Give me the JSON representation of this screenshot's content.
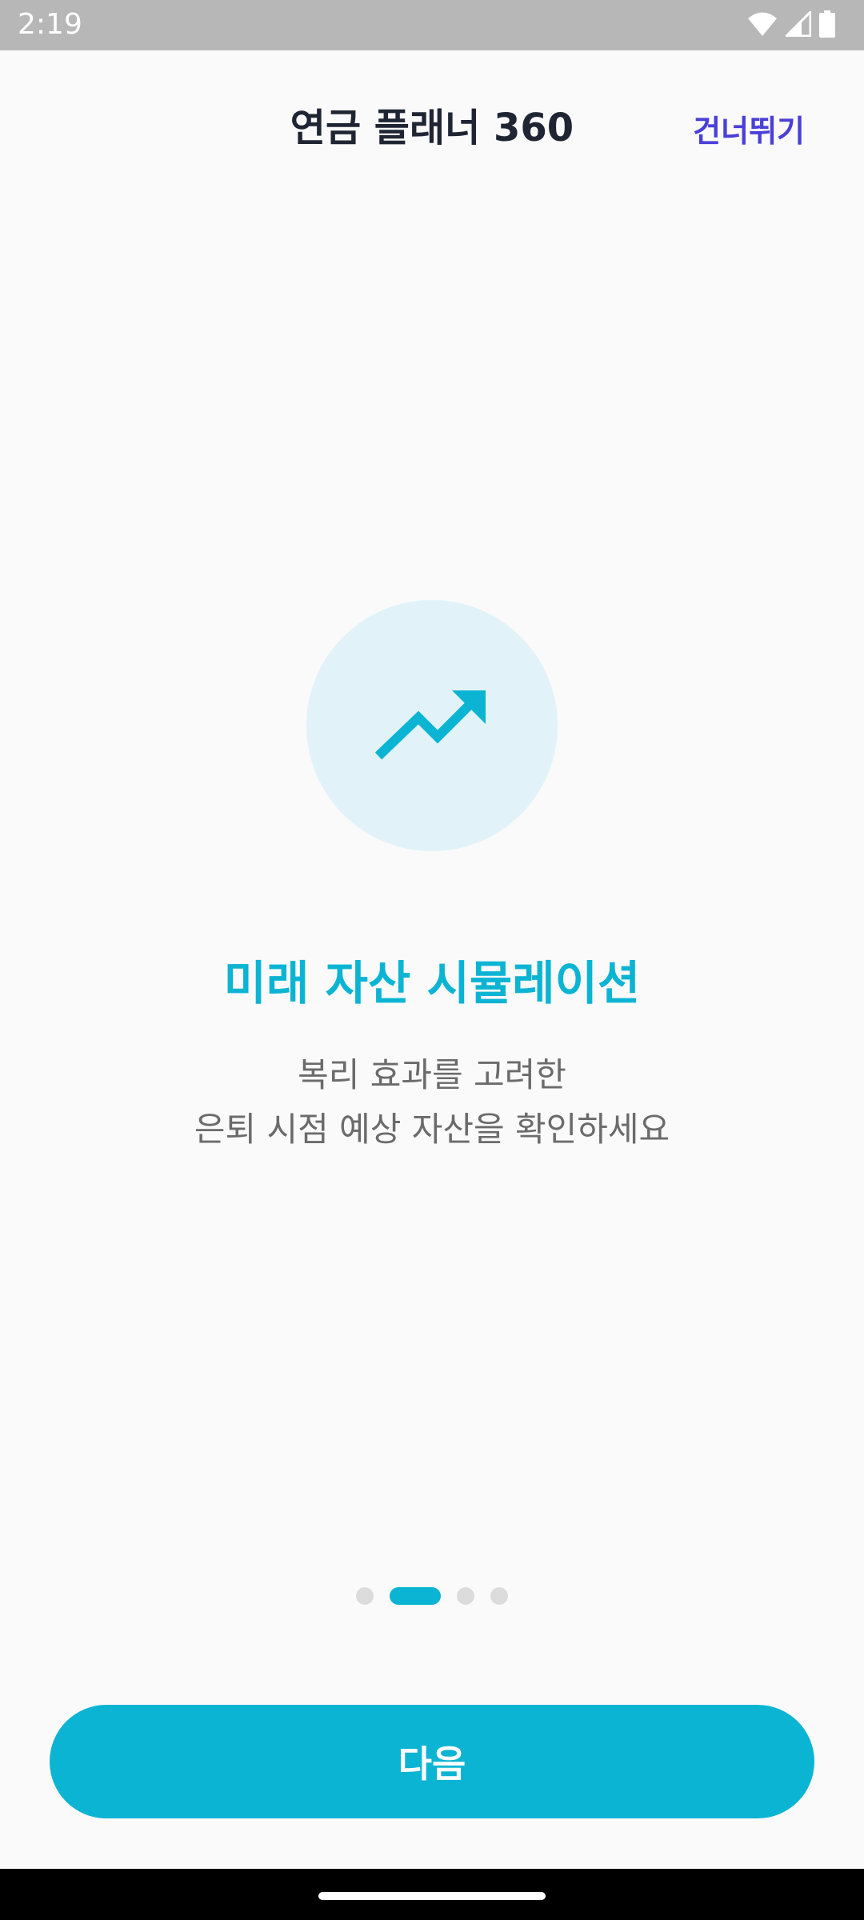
{
  "status_bar": {
    "time": "2:19",
    "icons": [
      "wifi-icon",
      "signal-icon",
      "battery-icon"
    ]
  },
  "header": {
    "title": "연금 플래너 360",
    "skip_label": "건너뛰기"
  },
  "slide": {
    "icon": "trending-up-icon",
    "title": "미래 자산 시뮬레이션",
    "description_line1": "복리 효과를 고려한",
    "description_line2": "은퇴 시점 예상 자산을 확인하세요"
  },
  "pager": {
    "total_pages": 4,
    "current_page": 2
  },
  "actions": {
    "next_label": "다음"
  },
  "colors": {
    "accent": "#0bb4d3",
    "skip_link": "#4a3fd8",
    "title_text": "#1f2533",
    "body_text": "#6b6b6b",
    "hero_circle": "#e1f3f8",
    "status_bar": "#b7b7b7",
    "background": "#fafafa"
  }
}
